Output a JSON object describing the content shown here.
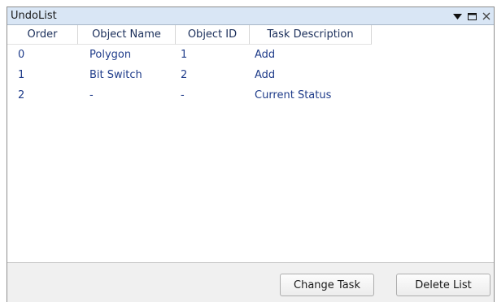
{
  "window": {
    "title": "UndoList",
    "controls": {
      "menu_icon": "triangle-down-icon",
      "maximize_icon": "maximize-icon",
      "close_icon": "close-icon"
    }
  },
  "table": {
    "columns": [
      "Order",
      "Object Name",
      "Object ID",
      "Task Description"
    ],
    "rows": [
      {
        "order": "0",
        "object_name": "Polygon",
        "object_id": "1",
        "task": "Add"
      },
      {
        "order": "1",
        "object_name": "Bit Switch",
        "object_id": "2",
        "task": "Add"
      },
      {
        "order": "2",
        "object_name": "-",
        "object_id": "-",
        "task": "Current Status"
      }
    ]
  },
  "buttons": {
    "change_task": "Change Task",
    "delete_list": "Delete List"
  },
  "colors": {
    "titlebar": "#d9e6f5",
    "cell_text": "#1f3c8a",
    "header_text": "#1a2e5a"
  }
}
